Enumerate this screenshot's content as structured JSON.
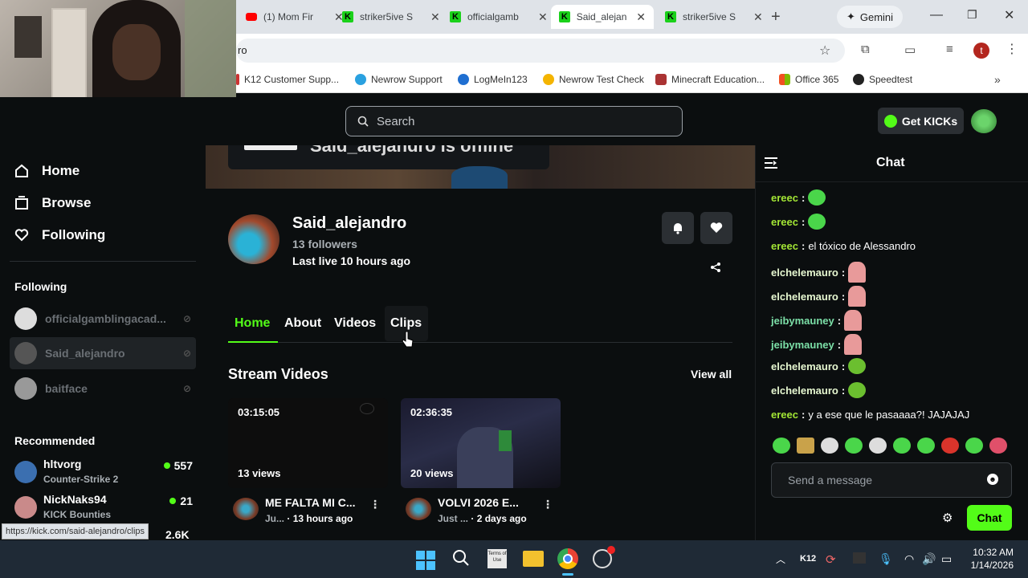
{
  "browser": {
    "tabs": [
      {
        "label": "(1) Mom Fir",
        "favicon": "youtube-icon"
      },
      {
        "label": "striker5ive S",
        "favicon": "kick-icon"
      },
      {
        "label": "officialgamb",
        "favicon": "kick-icon"
      },
      {
        "label": "Said_alejand",
        "favicon": "kick-icon",
        "active": true
      },
      {
        "label": "striker5ive S",
        "favicon": "kick-icon"
      }
    ],
    "gemini_label": "Gemini",
    "address_fragment": "ro",
    "profile_initial": "t",
    "bookmarks": [
      "K12 Customer Supp...",
      "Newrow Support",
      "LogMeIn123",
      "Newrow Test Check",
      "Minecraft Education...",
      "Office 365",
      "Speedtest"
    ]
  },
  "header": {
    "search_placeholder": "Search",
    "get_kicks_label": "Get KICKs"
  },
  "sidebar": {
    "nav": [
      {
        "label": "Home",
        "icon": "home-icon"
      },
      {
        "label": "Browse",
        "icon": "browse-icon"
      },
      {
        "label": "Following",
        "icon": "heart-icon"
      }
    ],
    "following_heading": "Following",
    "following": [
      {
        "name": "officialgamblingacad..."
      },
      {
        "name": "Said_alejandro"
      },
      {
        "name": "baitface"
      }
    ],
    "recommended_heading": "Recommended",
    "recommended": [
      {
        "name": "hltvorg",
        "game": "Counter-Strike 2",
        "viewers": "557"
      },
      {
        "name": "NickNaks94",
        "game": "KICK Bounties",
        "viewers": "21"
      },
      {
        "name": "",
        "game": "",
        "viewers": "2.6K"
      }
    ]
  },
  "channel": {
    "banner_text": "Said_alejandro is offline",
    "name": "Said_alejandro",
    "followers": "13 followers",
    "last_live": "Last live 10 hours ago",
    "tabs": [
      "Home",
      "About",
      "Videos",
      "Clips"
    ],
    "active_tab": "Home",
    "stream_videos_heading": "Stream Videos",
    "view_all_label": "View all",
    "videos": [
      {
        "duration": "03:15:05",
        "views": "13 views",
        "title": "ME FALTA MI C...",
        "category": "Ju...",
        "age": "· 13 hours ago"
      },
      {
        "duration": "02:36:35",
        "views": "20 views",
        "title": "VOLVI 2026 E...",
        "category": "Just ...",
        "age": "· 2 days ago"
      }
    ]
  },
  "chat": {
    "title": "Chat",
    "messages": [
      {
        "user": "ereec",
        "color": "#a3e635",
        "text": ""
      },
      {
        "user": "ereec",
        "color": "#a3e635",
        "text": ""
      },
      {
        "user": "ereec",
        "color": "#a3e635",
        "text": "el tóxico de Alessandro"
      },
      {
        "user": "elchelemauro",
        "color": "#e6f7d0",
        "text": ""
      },
      {
        "user": "elchelemauro",
        "color": "#e6f7d0",
        "text": ""
      },
      {
        "user": "jeibymauney",
        "color": "#7ce0a8",
        "text": ""
      },
      {
        "user": "jeibymauney",
        "color": "#7ce0a8",
        "text": ""
      },
      {
        "user": "elchelemauro",
        "color": "#e6f7d0",
        "text": ""
      },
      {
        "user": "elchelemauro",
        "color": "#e6f7d0",
        "text": ""
      },
      {
        "user": "ereec",
        "color": "#a3e635",
        "text": "y a ese que le pasaaaa?! JAJAJAJ"
      }
    ],
    "send_placeholder": "Send a message",
    "chat_button": "Chat"
  },
  "status_link": "https://kick.com/said-alejandro/clips",
  "taskbar": {
    "k12_label": "K12",
    "time": "10:32 AM",
    "date": "1/14/2026"
  },
  "colors": {
    "kick_green": "#53fc18",
    "background": "#0b0e0f"
  }
}
